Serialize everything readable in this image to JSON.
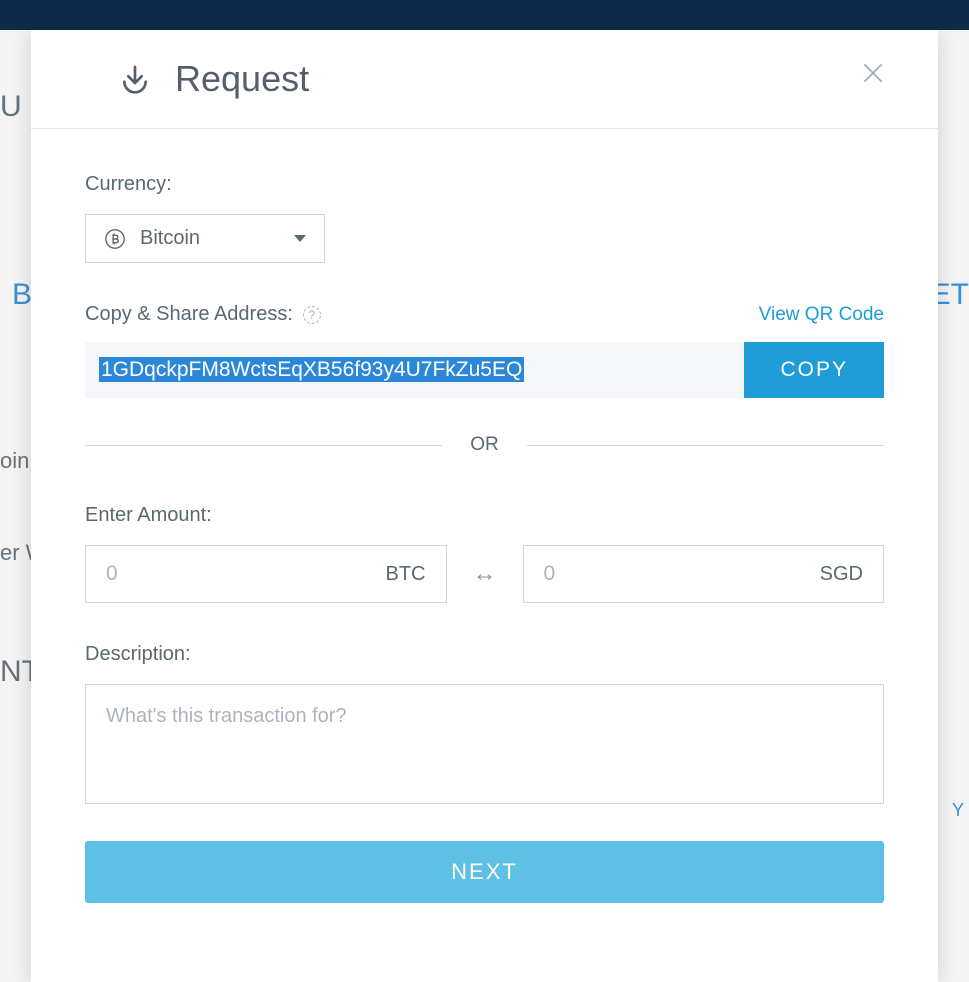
{
  "modal": {
    "title": "Request",
    "currency": {
      "label": "Currency:",
      "selected": "Bitcoin"
    },
    "address": {
      "label": "Copy & Share Address:",
      "qr_link": "View QR Code",
      "value": "1GDqckpFM8WctsEqXB56f93y4U7FkZu5EQ",
      "copy_button": "COPY"
    },
    "divider_text": "OR",
    "amount": {
      "label": "Enter Amount:",
      "crypto_placeholder": "0",
      "crypto_suffix": "BTC",
      "fiat_placeholder": "0",
      "fiat_suffix": "SGD"
    },
    "description": {
      "label": "Description:",
      "placeholder": "What's this transaction for?"
    },
    "next_button": "NEXT"
  },
  "background": {
    "title_fragment_1": "U",
    "title_fragment_2": "B",
    "title_fragment_3": "oin",
    "title_fragment_4": "er W",
    "title_fragment_5": "NT",
    "title_fragment_6": "ET",
    "title_fragment_7": "Y"
  }
}
